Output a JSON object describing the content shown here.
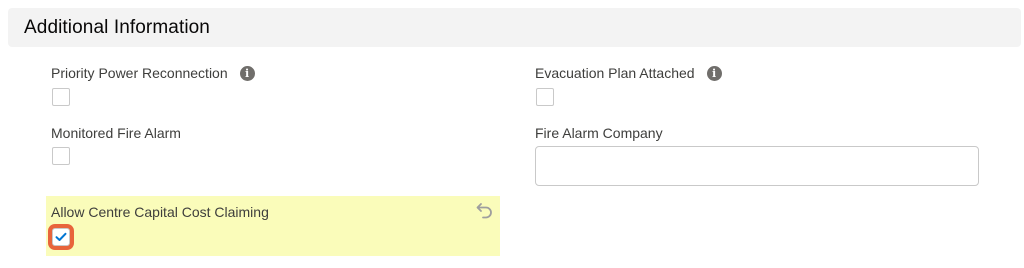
{
  "section": {
    "title": "Additional Information"
  },
  "fields": {
    "priority_power_reconnection": {
      "label": "Priority Power Reconnection",
      "checked": false,
      "info_icon": "info-icon"
    },
    "evacuation_plan_attached": {
      "label": "Evacuation Plan Attached",
      "checked": false,
      "info_icon": "info-icon"
    },
    "monitored_fire_alarm": {
      "label": "Monitored Fire Alarm",
      "checked": false
    },
    "fire_alarm_company": {
      "label": "Fire Alarm Company",
      "value": ""
    },
    "allow_centre_capital_cost_claiming": {
      "label": "Allow Centre Capital Cost Claiming",
      "checked": true,
      "edited": true,
      "undo_icon": "undo-icon"
    }
  },
  "colors": {
    "header_bg": "#f3f3f3",
    "edited_highlight": "#fafcba",
    "focus_ring": "#e8643b",
    "check_mark": "#0176d3",
    "info_icon": "#706e6b"
  }
}
